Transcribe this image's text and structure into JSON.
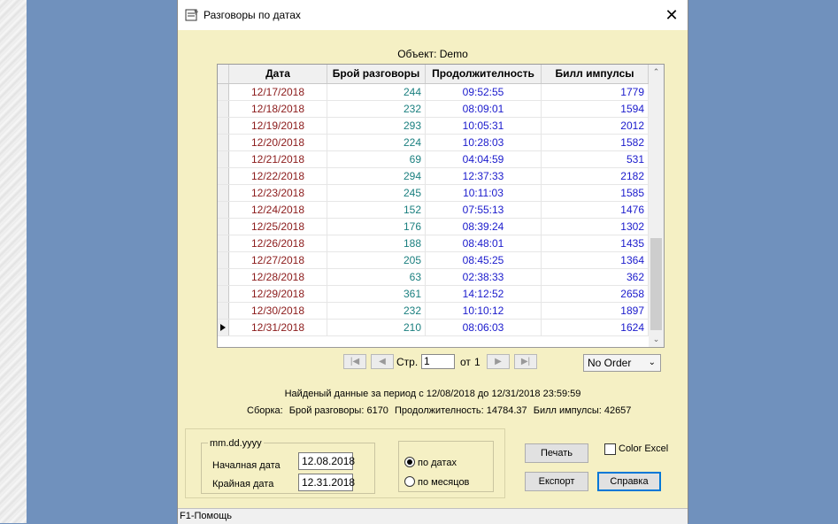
{
  "window": {
    "title": "Разговоры по датах",
    "close_glyph": "✕",
    "object_label": "Объект: Demo"
  },
  "grid": {
    "columns": [
      "Дата",
      "Брой разговоры",
      "Продолжителность",
      "Билл импулсы"
    ],
    "rows": [
      {
        "date": "12/17/2018",
        "calls": "244",
        "duration": "09:52:55",
        "bill": "1779"
      },
      {
        "date": "12/18/2018",
        "calls": "232",
        "duration": "08:09:01",
        "bill": "1594"
      },
      {
        "date": "12/19/2018",
        "calls": "293",
        "duration": "10:05:31",
        "bill": "2012"
      },
      {
        "date": "12/20/2018",
        "calls": "224",
        "duration": "10:28:03",
        "bill": "1582"
      },
      {
        "date": "12/21/2018",
        "calls": "69",
        "duration": "04:04:59",
        "bill": "531"
      },
      {
        "date": "12/22/2018",
        "calls": "294",
        "duration": "12:37:33",
        "bill": "2182"
      },
      {
        "date": "12/23/2018",
        "calls": "245",
        "duration": "10:11:03",
        "bill": "1585"
      },
      {
        "date": "12/24/2018",
        "calls": "152",
        "duration": "07:55:13",
        "bill": "1476"
      },
      {
        "date": "12/25/2018",
        "calls": "176",
        "duration": "08:39:24",
        "bill": "1302"
      },
      {
        "date": "12/26/2018",
        "calls": "188",
        "duration": "08:48:01",
        "bill": "1435"
      },
      {
        "date": "12/27/2018",
        "calls": "205",
        "duration": "08:45:25",
        "bill": "1364"
      },
      {
        "date": "12/28/2018",
        "calls": "63",
        "duration": "02:38:33",
        "bill": "362"
      },
      {
        "date": "12/29/2018",
        "calls": "361",
        "duration": "14:12:52",
        "bill": "2658"
      },
      {
        "date": "12/30/2018",
        "calls": "232",
        "duration": "10:10:12",
        "bill": "1897"
      },
      {
        "date": "12/31/2018",
        "calls": "210",
        "duration": "08:06:03",
        "bill": "1624"
      }
    ],
    "current_row_index": 14
  },
  "pager": {
    "first_glyph": "|◀",
    "prev_glyph": "◀",
    "next_glyph": "▶",
    "last_glyph": "▶|",
    "page_label": "Стр.",
    "page_value": "1",
    "of_label": "от",
    "total_pages": "1"
  },
  "order_select": {
    "value": "No Order",
    "arrow": "⌄"
  },
  "found_text": "Найденый данные за период с 12/08/2018  до 12/31/2018 23:59:59",
  "summary": {
    "label": "Сборка:",
    "calls": "Брой разговоры: 6170",
    "duration": "Продолжителность:  14784.37",
    "bill": "Билл импулсы: 42657"
  },
  "dates": {
    "format": "mm.dd.yyyy",
    "start_label": "Началная дата",
    "start_value": "12.08.2018",
    "end_label": "Крайная дата",
    "end_value": "12.31.2018"
  },
  "grouping": {
    "by_dates_label": "по датах",
    "by_months_label": "по месяцов",
    "selected": "by_dates"
  },
  "buttons": {
    "print": "Печать",
    "export": "Експорт",
    "help": "Справка"
  },
  "color_excel": {
    "label": "Color Excel",
    "checked": false
  },
  "status": "F1-Помощь",
  "colors": {
    "dialog_bg": "#f5f0c4",
    "desktop_bg": "#7091bd",
    "date_text": "#8b1a1a",
    "calls_text": "#1a7f7f",
    "value_text": "#1a1acc",
    "default_button_border": "#0078d7"
  }
}
